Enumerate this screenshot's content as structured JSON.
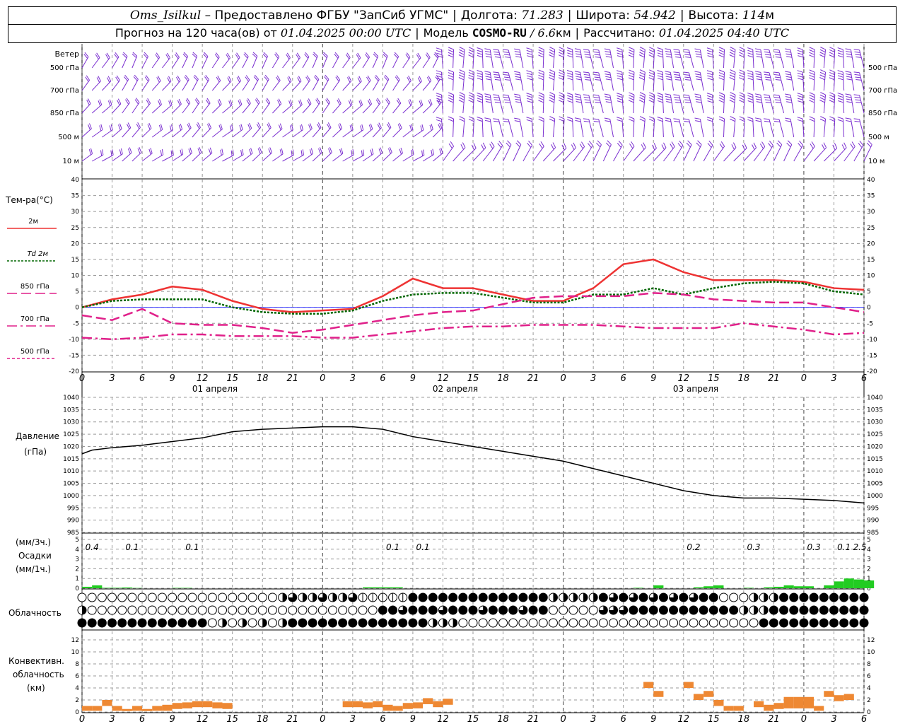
{
  "header": {
    "station": "Oms_Isilkul",
    "provider": "– Предоставлено ФГБУ \"ЗапСиб УГМС\"",
    "lon_label": "Долгота:",
    "lon_value": "71.283",
    "lat_label": "Широта:",
    "lat_value": "54.942",
    "alt_label": "Высота:",
    "alt_value": "114",
    "alt_unit": "м",
    "forecast_prefix": "Прогноз на 120 часа(ов) от",
    "forecast_start": "01.04.2025 00:00 UTC",
    "model_label": "Модель",
    "model_name": "COSMO-RU",
    "model_res": "/ 6.6",
    "model_res_unit": "км",
    "calc_label": "Рассчитано:",
    "calc_time": "01.04.2025 04:40 UTC"
  },
  "wind_panel": {
    "title": "Ветер",
    "levels": [
      "500 гПа",
      "700 гПа",
      "850 гПа",
      "500 м",
      "10 м"
    ],
    "color": "#7b2fd0"
  },
  "temp_panel": {
    "title": "Тем-ра(°C)",
    "legend": [
      "2м",
      "Td 2м",
      "850 гПа",
      "700 гПа",
      "500 гПа"
    ]
  },
  "pressure_panel": {
    "title_line1": "Давление",
    "title_line2": "(гПа)"
  },
  "precip_panel": {
    "unit3h": "(мм/3ч.)",
    "title": "Осадки",
    "unit1h": "(мм/1ч.)",
    "labels": [
      "0.4",
      "0.1",
      "0.1",
      "0.1",
      "0.1",
      "0.2",
      "0.3",
      "0.3",
      "0.1",
      "2.5"
    ]
  },
  "cloud_panel": {
    "title": "Облачность"
  },
  "conv_panel": {
    "title_line1": "Конвективн.",
    "title_line2": "облачность",
    "title_line3": "(км)"
  },
  "day_labels": [
    "01 апреля",
    "02 апреля",
    "03 апреля"
  ],
  "hour_ticks": [
    "0",
    "3",
    "6",
    "9",
    "12",
    "15",
    "18",
    "21",
    "0",
    "3",
    "6",
    "9",
    "12",
    "15",
    "18",
    "21",
    "0",
    "3",
    "6",
    "9",
    "12",
    "15",
    "18",
    "21",
    "0",
    "3",
    "6"
  ],
  "colors": {
    "t2m": "#ee3333",
    "td2m": "#006600",
    "t850": "#e0208a",
    "t700": "#e0208a",
    "t500": "#e0208a",
    "pressure": "#000000",
    "precip": "#22cc22",
    "conv": "#ee8833",
    "grid": "#999999"
  },
  "chart_data": [
    {
      "type": "line",
      "title": "Тем-ра(°C)",
      "ylim": [
        -20,
        40
      ],
      "yticks": [
        -20,
        -15,
        -10,
        -5,
        0,
        5,
        10,
        15,
        20,
        25,
        30,
        35,
        40
      ],
      "x": [
        0,
        3,
        6,
        9,
        12,
        15,
        18,
        21,
        24,
        27,
        30,
        33,
        36,
        39,
        42,
        45,
        48,
        51,
        54,
        57,
        60,
        63,
        66,
        69,
        72,
        75,
        78
      ],
      "series": [
        {
          "name": "2м",
          "values": [
            0,
            2.5,
            4,
            6.5,
            5.5,
            2,
            -0.5,
            -1.5,
            -1,
            -0.5,
            3.5,
            9,
            6,
            6,
            4,
            2,
            2,
            6,
            13.5,
            15,
            11,
            8.5,
            8.5,
            8.5,
            8,
            6,
            5.5
          ]
        },
        {
          "name": "Td 2м",
          "values": [
            0,
            2,
            2.5,
            2.5,
            2.5,
            0,
            -1.5,
            -2,
            -2,
            -1,
            2,
            4,
            4.5,
            4.5,
            3,
            1.5,
            1.5,
            4,
            4,
            6,
            4,
            6,
            7.5,
            8,
            7.5,
            5,
            4
          ]
        },
        {
          "name": "850 гПа",
          "values": [
            -2.5,
            -4,
            -0.5,
            -5,
            -5.5,
            -5.5,
            -6.5,
            -8,
            -7,
            -5.5,
            -4,
            -2.5,
            -1.5,
            -1,
            1,
            3,
            3.5,
            3.5,
            3.5,
            4.5,
            4,
            2.5,
            2,
            1.5,
            1.5,
            0,
            -1.5
          ]
        },
        {
          "name": "700 гПа",
          "values": [
            -9.5,
            -10,
            -9.5,
            -8.5,
            -8.5,
            -9,
            -9,
            -9,
            -9.5,
            -9.5,
            -8.5,
            -7.5,
            -6.5,
            -6,
            -6,
            -5.5,
            -5.5,
            -5.5,
            -6,
            -6.5,
            -6.5,
            -6.5,
            -5,
            -6,
            -7,
            -8.5,
            -8
          ]
        },
        {
          "name": "500 гПа",
          "values": []
        }
      ]
    },
    {
      "type": "line",
      "title": "Давление",
      "ylabel": "(гПа)",
      "ylim": [
        985,
        1040
      ],
      "yticks": [
        985,
        990,
        995,
        1000,
        1005,
        1010,
        1015,
        1020,
        1025,
        1030,
        1035,
        1040
      ],
      "x": [
        0,
        1,
        3,
        6,
        9,
        12,
        15,
        18,
        21,
        24,
        27,
        30,
        33,
        36,
        39,
        42,
        45,
        48,
        51,
        54,
        57,
        60,
        63,
        66,
        69,
        72,
        75,
        78
      ],
      "series": [
        {
          "name": "Давление",
          "values": [
            1017,
            1018.5,
            1019.5,
            1020.5,
            1022,
            1023.5,
            1026,
            1027,
            1027.5,
            1028,
            1028,
            1027,
            1024,
            1022,
            1020,
            1018,
            1016,
            1014,
            1011,
            1008,
            1005,
            1002,
            1000,
            999,
            999,
            998.5,
            998,
            997
          ]
        }
      ]
    },
    {
      "type": "bar",
      "title": "Осадки",
      "ylim": [
        0,
        5
      ],
      "yticks": [
        0,
        1,
        2,
        3,
        4,
        5
      ],
      "x": [
        0,
        1,
        2,
        3,
        4,
        5,
        9,
        10,
        28,
        29,
        30,
        31,
        55,
        57,
        61,
        62,
        63,
        66,
        68,
        69,
        70,
        71,
        72,
        74,
        75,
        76,
        77,
        78
      ],
      "values": [
        0.15,
        0.3,
        0.05,
        0.05,
        0.08,
        0.03,
        0.04,
        0.04,
        0.1,
        0.1,
        0.1,
        0.1,
        0.05,
        0.3,
        0.1,
        0.2,
        0.3,
        0.05,
        0.1,
        0.15,
        0.3,
        0.2,
        0.2,
        0.3,
        0.7,
        1.0,
        0.9,
        0.8
      ]
    },
    {
      "type": "bar",
      "title": "Конвективн. облачность (км)",
      "ylim": [
        0,
        12
      ],
      "yticks": [
        0,
        2,
        4,
        6,
        8,
        10,
        12
      ],
      "segments": [
        [
          0,
          1.0
        ],
        [
          1,
          1.0
        ],
        [
          2,
          2.0
        ],
        [
          3,
          1.0
        ],
        [
          4,
          0.5
        ],
        [
          5,
          1.0
        ],
        [
          6,
          0.5
        ],
        [
          7,
          1.0
        ],
        [
          8,
          1.2
        ],
        [
          9,
          1.5
        ],
        [
          10,
          1.6
        ],
        [
          11,
          1.8
        ],
        [
          12,
          1.8
        ],
        [
          13,
          1.6
        ],
        [
          14,
          1.5
        ],
        [
          26,
          1.8
        ],
        [
          27,
          1.8
        ],
        [
          28,
          1.6
        ],
        [
          29,
          1.8
        ],
        [
          30,
          1.2
        ],
        [
          31,
          1.0
        ],
        [
          32,
          1.5
        ],
        [
          33,
          1.6
        ],
        [
          34,
          2.3
        ],
        [
          35,
          1.8
        ],
        [
          36,
          2.2
        ],
        [
          56,
          5.0
        ],
        [
          57,
          3.5
        ],
        [
          60,
          5.0
        ],
        [
          61,
          3.0
        ],
        [
          62,
          3.5
        ],
        [
          63,
          2.0
        ],
        [
          64,
          1.0
        ],
        [
          65,
          1.0
        ],
        [
          67,
          1.8
        ],
        [
          68,
          1.2
        ],
        [
          69,
          1.5
        ],
        [
          70,
          2.5
        ],
        [
          71,
          2.5
        ],
        [
          72,
          2.5
        ],
        [
          73,
          1.0
        ],
        [
          74,
          3.5
        ],
        [
          75,
          2.8
        ],
        [
          76,
          3.0
        ]
      ]
    }
  ]
}
